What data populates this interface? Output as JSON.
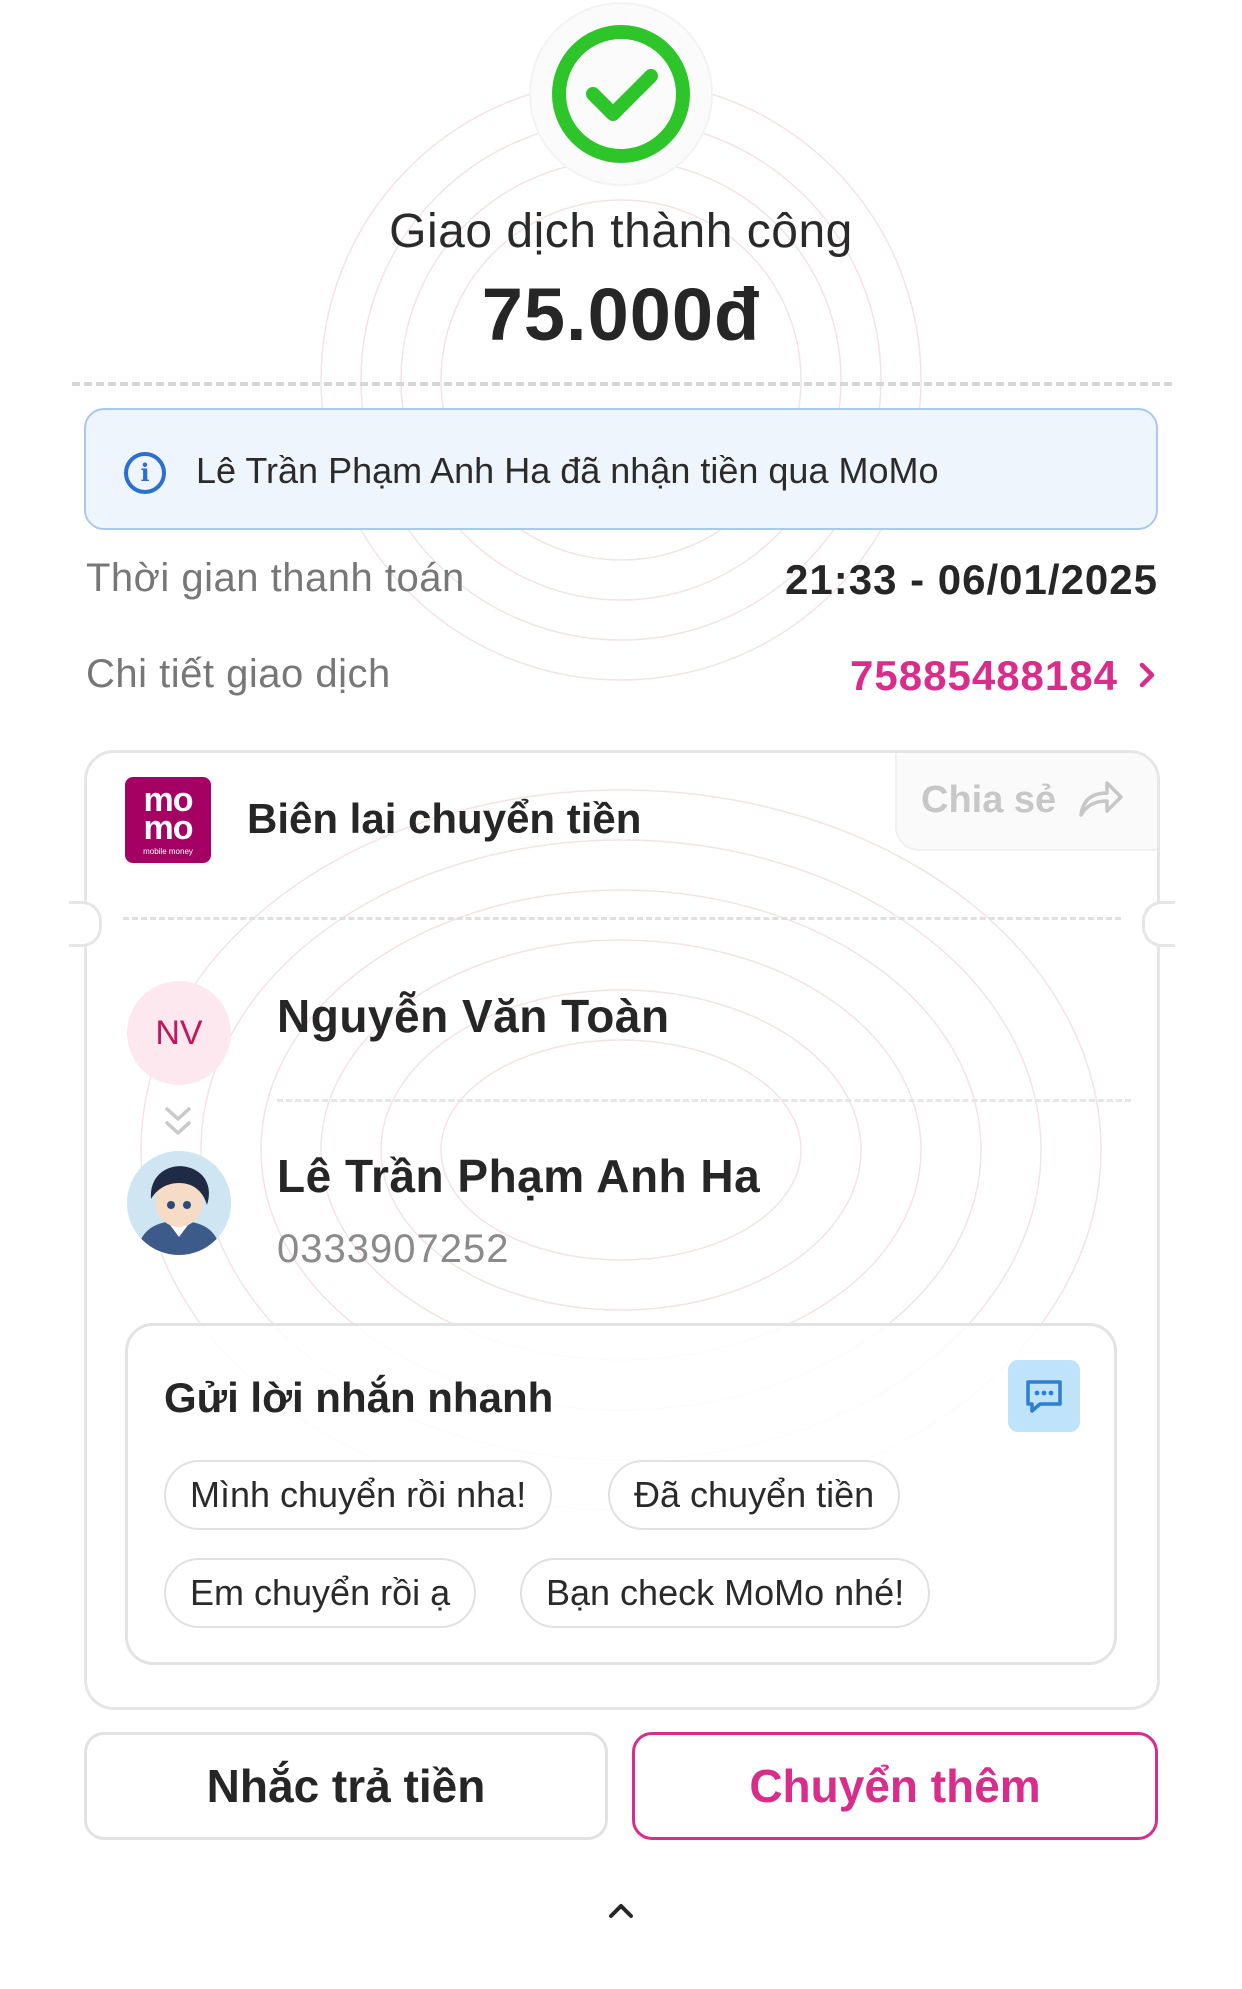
{
  "header": {
    "status_icon": "check-circle-icon",
    "status_color": "#2ec52a",
    "title": "Giao dịch thành công",
    "amount": "75.000đ"
  },
  "info_banner": {
    "icon": "info-icon",
    "text": "Lê Trần Phạm Anh Ha đã nhận tiền qua MoMo"
  },
  "details": {
    "time_label": "Thời gian thanh toán",
    "time_value": "21:33 - 06/01/2025",
    "txn_label": "Chi tiết giao dịch",
    "txn_value": "75885488184",
    "txn_color": "#d82d8b"
  },
  "receipt": {
    "logo_line1": "mo",
    "logo_line2": "mo",
    "logo_tagline": "mobile money",
    "logo_color": "#a50064",
    "title": "Biên lai chuyển tiền",
    "share_label": "Chia sẻ",
    "sender": {
      "initials": "NV",
      "name": "Nguyễn Văn Toàn"
    },
    "receiver": {
      "name": "Lê Trần Phạm Anh Ha",
      "phone": "0333907252"
    }
  },
  "quick_message": {
    "title": "Gửi lời nhắn nhanh",
    "chips": [
      "Mình chuyển rồi nha!",
      "Đã chuyển tiền",
      "Em chuyển rồi ạ",
      "Bạn check MoMo nhé!"
    ]
  },
  "actions": {
    "remind_label": "Nhắc trả tiền",
    "transfer_label": "Chuyển thêm",
    "accent": "#d82d8b"
  }
}
